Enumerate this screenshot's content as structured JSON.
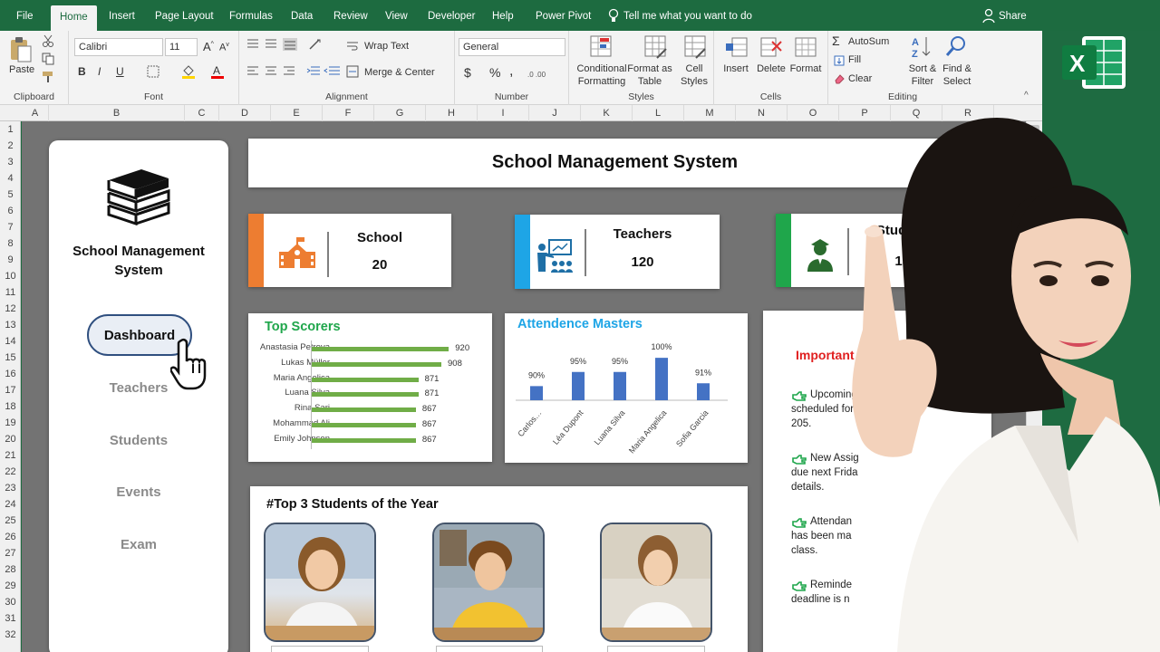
{
  "menu": {
    "tabs": [
      "File",
      "Home",
      "Insert",
      "Page Layout",
      "Formulas",
      "Data",
      "Review",
      "View",
      "Developer",
      "Help",
      "Power Pivot"
    ],
    "tell_me": "Tell me what you want to do",
    "share": "Share"
  },
  "ribbon": {
    "clipboard": {
      "paste": "Paste",
      "label": "Clipboard"
    },
    "font": {
      "name": "Calibri",
      "size": "11",
      "label": "Font",
      "bold": "B",
      "italic": "I",
      "underline": "U"
    },
    "alignment": {
      "wrap": "Wrap Text",
      "merge": "Merge & Center",
      "label": "Alignment"
    },
    "number": {
      "format": "General",
      "currency": "$",
      "percent": "%",
      "comma": ",",
      "label": "Number"
    },
    "styles": {
      "conditional": "Conditional",
      "conditional2": "Formatting",
      "format_as": "Format as",
      "format_as2": "Table",
      "cell": "Cell",
      "cell2": "Styles",
      "label": "Styles"
    },
    "cells": {
      "insert": "Insert",
      "delete": "Delete",
      "format": "Format",
      "label": "Cells"
    },
    "editing": {
      "autosum": "AutoSum",
      "fill": "Fill",
      "clear": "Clear",
      "sort": "Sort &",
      "sort2": "Filter",
      "find": "Find &",
      "find2": "Select",
      "label": "Editing"
    }
  },
  "grid": {
    "columns": [
      "A",
      "B",
      "C",
      "D",
      "E",
      "F",
      "G",
      "H",
      "I",
      "J",
      "K",
      "L",
      "M",
      "N",
      "O",
      "P",
      "Q",
      "R"
    ],
    "rows": [
      "1",
      "2",
      "3",
      "4",
      "5",
      "6",
      "7",
      "8",
      "9",
      "10",
      "11",
      "12",
      "13",
      "14",
      "15",
      "16",
      "17",
      "18",
      "19",
      "20",
      "21",
      "22",
      "23",
      "24",
      "25",
      "26",
      "27",
      "28",
      "29",
      "30",
      "31",
      "32"
    ]
  },
  "sidebar": {
    "title_line1": "School Management",
    "title_line2": "System",
    "nav": [
      "Dashboard",
      "Teachers",
      "Students",
      "Events",
      "Exam"
    ]
  },
  "header": {
    "title": "School Management System"
  },
  "kpis": [
    {
      "label": "School",
      "value": "20",
      "color": "#ed7d31",
      "icon": "school-icon"
    },
    {
      "label": "Teachers",
      "value": "120",
      "color": "#1ea5e6",
      "icon": "teacher-icon"
    },
    {
      "label": "Students",
      "value": "1520",
      "color": "#1fa64b",
      "icon": "student-icon"
    }
  ],
  "top_scorers": {
    "title": "Top Scorers",
    "title_color": "#1fa64b",
    "bar_color": "#70ad47"
  },
  "attendance": {
    "title": "Attendence Masters",
    "title_color": "#1ea5e6",
    "bar_color": "#4472c4"
  },
  "chart_data": [
    {
      "type": "bar",
      "orientation": "horizontal",
      "title": "Top Scorers",
      "categories": [
        "Anastasia Petrova",
        "Lukas Müller",
        "Maria Angelica",
        "Luana Silva",
        "Rina Sari",
        "Mohammad Ali",
        "Emily Johnson"
      ],
      "values": [
        920,
        908,
        871,
        871,
        867,
        867,
        867
      ],
      "xlim": [
        700,
        940
      ]
    },
    {
      "type": "bar",
      "title": "Attendence Masters",
      "categories": [
        "Carlos…",
        "Léa Dupont",
        "Luana Silva",
        "Maria Angelica",
        "Sofia Garcia"
      ],
      "values": [
        90,
        95,
        95,
        100,
        91
      ],
      "value_labels": [
        "90%",
        "95%",
        "95%",
        "100%",
        "91%"
      ],
      "ylim": [
        85,
        101
      ]
    }
  ],
  "notes": {
    "title": "Important Not",
    "title_tail": "...!!",
    "items": [
      [
        "Upcoming",
        "scheduled for to",
        "205."
      ],
      [
        "New Assig",
        "due next Frida",
        "details."
      ],
      [
        "Attendan",
        "has been ma",
        "class."
      ],
      [
        "Reminde",
        "deadline is n",
        ""
      ]
    ]
  },
  "top_students": {
    "title": "#Top 3 Students of the Year"
  }
}
